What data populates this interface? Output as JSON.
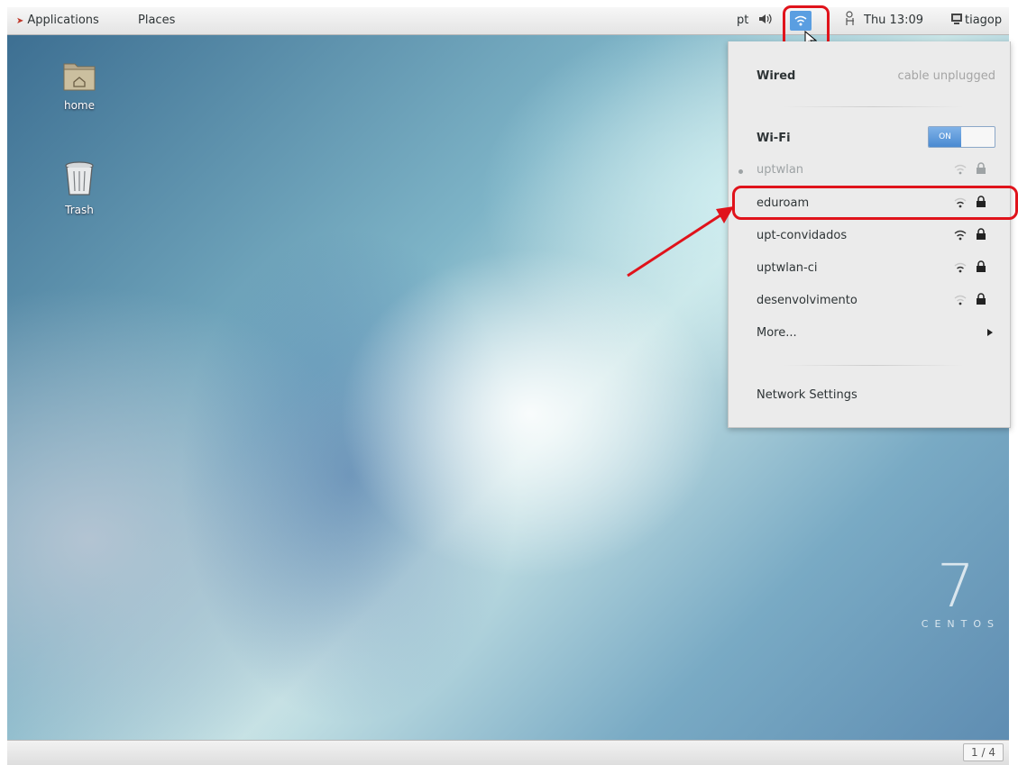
{
  "topbar": {
    "applications_label": "Applications",
    "places_label": "Places",
    "keyboard_layout": "pt",
    "clock": "Thu 13:09",
    "user_name": "tiagop"
  },
  "desktop": {
    "icons": [
      {
        "label": "home",
        "icon": "home-folder-icon"
      },
      {
        "label": "Trash",
        "icon": "trash-icon"
      }
    ],
    "logo_number": "7",
    "logo_text": "CENTOS"
  },
  "network_menu": {
    "wired_label": "Wired",
    "wired_status": "cable unplugged",
    "wifi_label": "Wi-Fi",
    "wifi_toggle": "ON",
    "networks": [
      {
        "name": "uptwlan",
        "signal": "weak",
        "secured": true,
        "connected_indicator": true
      },
      {
        "name": "eduroam",
        "signal": "medium",
        "secured": true
      },
      {
        "name": "upt-convidados",
        "signal": "strong",
        "secured": true
      },
      {
        "name": "uptwlan-ci",
        "signal": "medium",
        "secured": true
      },
      {
        "name": "desenvolvimento",
        "signal": "weak",
        "secured": true
      }
    ],
    "more_label": "More...",
    "settings_label": "Network Settings"
  },
  "annotations": {
    "color": "#e0131b"
  },
  "bottombar": {
    "workspace": "1 / 4"
  }
}
